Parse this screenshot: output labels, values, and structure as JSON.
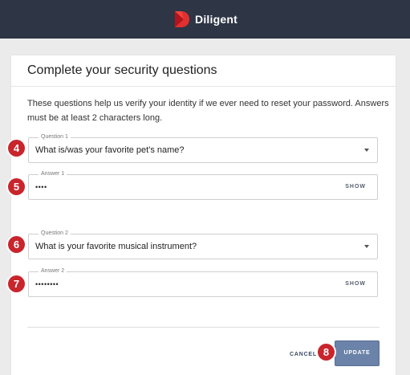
{
  "header": {
    "brand_name": "Diligent",
    "logo_icon": "diligent-logo-icon",
    "colors": {
      "bar": "#2e3545",
      "logo_dark": "#b0141c",
      "logo_light": "#e0302f"
    }
  },
  "card": {
    "title": "Complete your security questions",
    "intro": "These questions help us verify your identity if we ever need to reset your password. Answers must be at least 2 characters long."
  },
  "question1": {
    "label": "Question 1",
    "value": "What is/was your favorite pet's name?"
  },
  "answer1": {
    "label": "Answer 1",
    "value": "••••",
    "show_label": "SHOW"
  },
  "question2": {
    "label": "Question 2",
    "value": "What is your favorite musical instrument?"
  },
  "answer2": {
    "label": "Answer 2",
    "value": "••••••••",
    "show_label": "SHOW"
  },
  "actions": {
    "cancel_label": "CANCEL",
    "update_label": "UPDATE",
    "update_color": "#6b82a9"
  },
  "step_markers": {
    "color": "#c8252c",
    "question1": "4",
    "answer1": "5",
    "question2": "6",
    "answer2": "7",
    "update": "8"
  }
}
